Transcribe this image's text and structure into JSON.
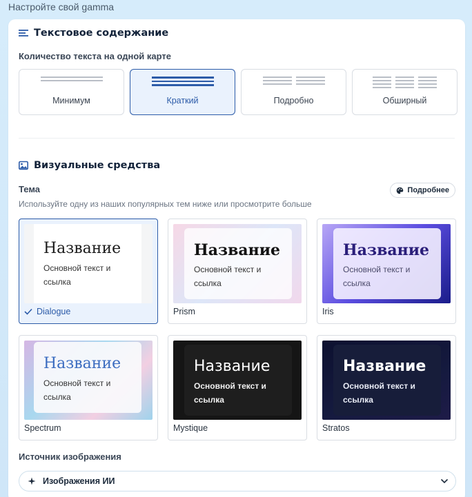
{
  "header": {
    "title": "Настройте свой gamma"
  },
  "text_content": {
    "heading": "Текстовое содержание",
    "amount_label": "Количество текста на одной карте",
    "options": [
      {
        "label": "Минимум",
        "selected": false
      },
      {
        "label": "Краткий",
        "selected": true
      },
      {
        "label": "Подробно",
        "selected": false
      },
      {
        "label": "Обширный",
        "selected": false
      }
    ]
  },
  "visuals": {
    "heading": "Визуальные средства",
    "theme_label": "Тема",
    "more_button": "Подробнее",
    "theme_hint": "Используйте одну из наших популярных тем ниже или просмотрите больше",
    "preview": {
      "title": "Название",
      "body": "Основной текст и ссылка"
    },
    "themes": [
      {
        "name": "Dialogue",
        "selected": true
      },
      {
        "name": "Prism",
        "selected": false
      },
      {
        "name": "Iris",
        "selected": false
      },
      {
        "name": "Spectrum",
        "selected": false
      },
      {
        "name": "Mystique",
        "selected": false
      },
      {
        "name": "Stratos",
        "selected": false
      }
    ],
    "image_source_label": "Источник изображения",
    "image_source_value": "Изображения ИИ"
  },
  "colors": {
    "accent": "#2c5ba8",
    "selected_bg": "#eaf2fd",
    "page_bg": "#d6ecfb"
  },
  "icons": [
    "text-lines-icon",
    "image-icon",
    "palette-icon",
    "check-icon",
    "sparkle-icon",
    "chevron-down-icon"
  ]
}
